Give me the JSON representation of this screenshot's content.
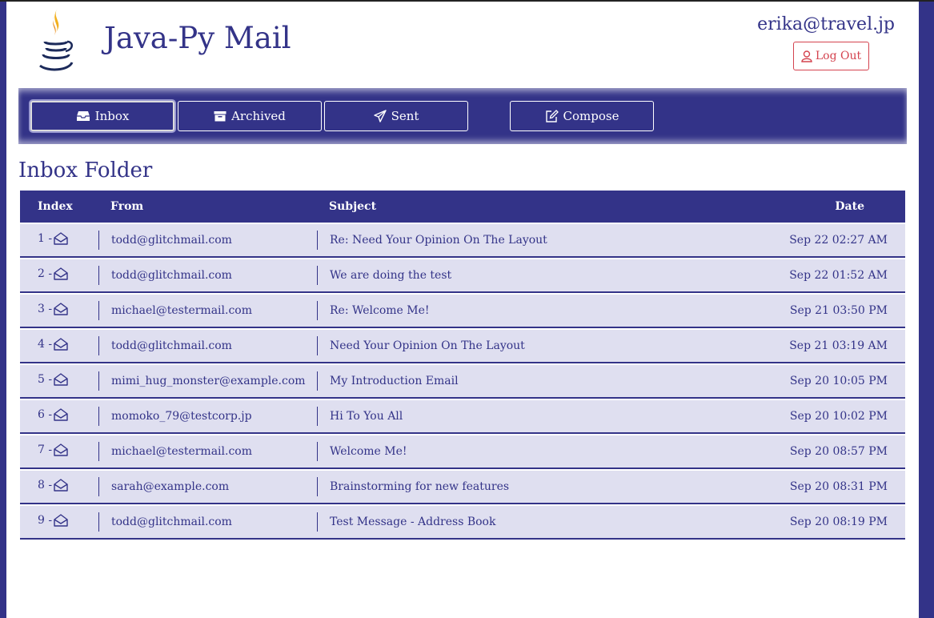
{
  "header": {
    "app_title": "Java-Py Mail",
    "user_email": "erika@travel.jp",
    "logout_label": "Log Out"
  },
  "nav": {
    "inbox_label": "Inbox",
    "archived_label": "Archived",
    "sent_label": "Sent",
    "compose_label": "Compose",
    "active": "Inbox"
  },
  "folder_title": "Inbox Folder",
  "table": {
    "columns": [
      "Index",
      "From",
      "Subject",
      "Date"
    ],
    "rows": [
      {
        "index": "1 -",
        "from": "todd@glitchmail.com",
        "subject": "Re: Need Your Opinion On The Layout",
        "date": "Sep 22 02:27 AM"
      },
      {
        "index": "2 -",
        "from": "todd@glitchmail.com",
        "subject": "We are doing the test",
        "date": "Sep 22 01:52 AM"
      },
      {
        "index": "3 -",
        "from": "michael@testermail.com",
        "subject": "Re: Welcome Me!",
        "date": "Sep 21 03:50 PM"
      },
      {
        "index": "4 -",
        "from": "todd@glitchmail.com",
        "subject": "Need Your Opinion On The Layout",
        "date": "Sep 21 03:19 AM"
      },
      {
        "index": "5 -",
        "from": "mimi_hug_monster@example.com",
        "subject": "My Introduction Email",
        "date": "Sep 20 10:05 PM"
      },
      {
        "index": "6 -",
        "from": "momoko_79@testcorp.jp",
        "subject": "Hi To You All",
        "date": "Sep 20 10:02 PM"
      },
      {
        "index": "7 -",
        "from": "michael@testermail.com",
        "subject": "Welcome Me!",
        "date": "Sep 20 08:57 PM"
      },
      {
        "index": "8 -",
        "from": "sarah@example.com",
        "subject": "Brainstorming for new features",
        "date": "Sep 20 08:31 PM"
      },
      {
        "index": "9 -",
        "from": "todd@glitchmail.com",
        "subject": "Test Message - Address Book",
        "date": "Sep 20 08:19 PM"
      }
    ]
  },
  "colors": {
    "primary": "#333388",
    "row_bg": "#dfdff0",
    "danger": "#d4434f"
  }
}
